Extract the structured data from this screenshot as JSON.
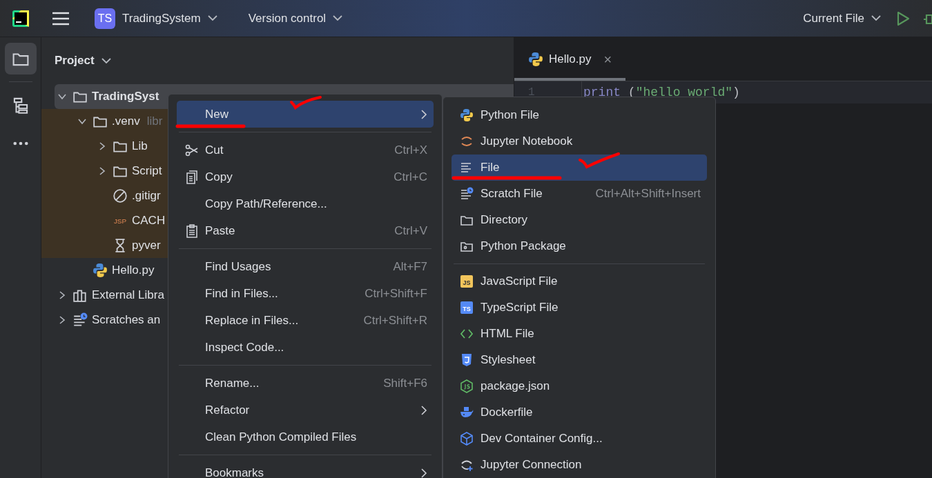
{
  "title_bar": {
    "project_badge": "TS",
    "project_name": "TradingSystem",
    "vcs": "Version control",
    "run_config": "Current File"
  },
  "tool_strip": [
    {
      "kind": "folder",
      "selected": true
    },
    {
      "kind": "structure",
      "selected": false
    },
    {
      "kind": "more",
      "selected": false
    }
  ],
  "project_panel": {
    "title": "Project",
    "tree": [
      {
        "label": "TradingSyst",
        "kind": "folder",
        "bold": true,
        "selected": true,
        "excluded": false,
        "expanded": true,
        "children": [
          {
            "label": ".venv",
            "hint": "libr",
            "kind": "folder",
            "bold": false,
            "selected": false,
            "excluded": true,
            "expanded": true,
            "children": [
              {
                "label": "Lib",
                "kind": "folder",
                "bold": false,
                "selected": false,
                "excluded": true,
                "expanded": false
              },
              {
                "label": "Script",
                "kind": "folder",
                "bold": false,
                "selected": false,
                "excluded": true,
                "expanded": false
              },
              {
                "label": ".gitigr",
                "kind": "ignore",
                "bold": false,
                "selected": false,
                "excluded": true
              },
              {
                "label": "CACH",
                "kind": "jsp",
                "icon_text": "JSP",
                "bold": false,
                "selected": false,
                "excluded": true
              },
              {
                "label": "pyver",
                "kind": "venv",
                "bold": false,
                "selected": false,
                "excluded": true
              }
            ]
          },
          {
            "label": "Hello.py",
            "kind": "python",
            "bold": false,
            "selected": false,
            "excluded": false
          }
        ]
      },
      {
        "label": "External Libra",
        "kind": "library",
        "bold": false,
        "selected": false,
        "excluded": false,
        "expanded": false
      },
      {
        "label": "Scratches an",
        "kind": "scratch",
        "bold": false,
        "selected": false,
        "excluded": false,
        "expanded": false
      }
    ]
  },
  "editor": {
    "tabs": [
      {
        "label": "Hello.py",
        "kind": "python",
        "selected": true,
        "close": "×"
      }
    ],
    "lines": [
      {
        "number": "1",
        "tokens": [
          {
            "kind": "builtin",
            "text": "print"
          },
          {
            "kind": "plain",
            "text": " ("
          },
          {
            "kind": "string",
            "text": "\"hello world\""
          },
          {
            "kind": "plain",
            "text": ")"
          }
        ]
      }
    ]
  },
  "context_menu": [
    {
      "kind": "plain",
      "label": "New",
      "selected": true,
      "submenu": true
    },
    {
      "kind": "separator"
    },
    {
      "kind": "scissors",
      "label": "Cut",
      "shortcut": "Ctrl+X",
      "selected": false,
      "submenu": false
    },
    {
      "kind": "copy",
      "label": "Copy",
      "shortcut": "Ctrl+C",
      "selected": false,
      "submenu": false
    },
    {
      "kind": "plain",
      "label": "Copy Path/Reference...",
      "selected": false,
      "submenu": false
    },
    {
      "kind": "paste",
      "label": "Paste",
      "shortcut": "Ctrl+V",
      "selected": false,
      "submenu": false
    },
    {
      "kind": "separator"
    },
    {
      "kind": "plain",
      "label": "Find Usages",
      "shortcut": "Alt+F7",
      "selected": false,
      "submenu": false
    },
    {
      "kind": "plain",
      "label": "Find in Files...",
      "shortcut": "Ctrl+Shift+F",
      "selected": false,
      "submenu": false
    },
    {
      "kind": "plain",
      "label": "Replace in Files...",
      "shortcut": "Ctrl+Shift+R",
      "selected": false,
      "submenu": false
    },
    {
      "kind": "plain",
      "label": "Inspect Code...",
      "selected": false,
      "submenu": false
    },
    {
      "kind": "separator"
    },
    {
      "kind": "plain",
      "label": "Rename...",
      "shortcut": "Shift+F6",
      "selected": false,
      "submenu": false
    },
    {
      "kind": "plain",
      "label": "Refactor",
      "selected": false,
      "submenu": true
    },
    {
      "kind": "plain",
      "label": "Clean Python Compiled Files",
      "selected": false,
      "submenu": false
    },
    {
      "kind": "separator"
    },
    {
      "kind": "plain",
      "label": "Bookmarks",
      "selected": false,
      "submenu": true
    }
  ],
  "new_submenu": [
    {
      "kind": "python",
      "label": "Python File",
      "selected": false
    },
    {
      "kind": "jupyter",
      "label": "Jupyter Notebook",
      "selected": false
    },
    {
      "kind": "text",
      "label": "File",
      "selected": true
    },
    {
      "kind": "scratch",
      "label": "Scratch File",
      "shortcut": "Ctrl+Alt+Shift+Insert",
      "selected": false
    },
    {
      "kind": "folder",
      "label": "Directory",
      "selected": false
    },
    {
      "kind": "package",
      "label": "Python Package",
      "selected": false
    },
    {
      "kind": "separator"
    },
    {
      "kind": "js",
      "icon_text": "JS",
      "label": "JavaScript File",
      "selected": false
    },
    {
      "kind": "ts",
      "icon_text": "TS",
      "label": "TypeScript File",
      "selected": false
    },
    {
      "kind": "html",
      "label": "HTML File",
      "selected": false
    },
    {
      "kind": "css",
      "label": "Stylesheet",
      "selected": false
    },
    {
      "kind": "node",
      "label": "package.json",
      "selected": false
    },
    {
      "kind": "docker",
      "label": "Dockerfile",
      "selected": false
    },
    {
      "kind": "cube",
      "label": "Dev Container Config...",
      "selected": false
    },
    {
      "kind": "connection",
      "label": "Jupyter Connection",
      "selected": false
    }
  ]
}
